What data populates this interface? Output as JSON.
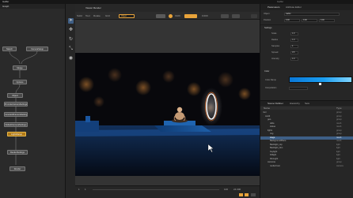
{
  "colors": {
    "accent_orange": "#e8a33a",
    "selection_blue": "#3e5f86",
    "gradient_start": "#0a78d8",
    "gradient_end": "#7fd4ff",
    "stage_blue": "#1e5fa8"
  },
  "app": {
    "title": "Gaffer",
    "top_left_menu": "Gaffer"
  },
  "nodegraph": {
    "tab": "Graph",
    "nodes": [
      "Sketch",
      "CameraSetup",
      "Merge",
      "Options",
      "Object",
      "PromoteCameraSettings",
      "PromoteAllCameraSettings",
      "DefaultCameraSettings",
      "LightsSetup",
      "RenderSettings",
      "Render"
    ]
  },
  "tools": [
    "select-icon",
    "translate-icon",
    "rotate-icon",
    "scale-icon",
    "camera-icon"
  ],
  "viewer": {
    "tab": "Viewer Render",
    "toolbar": {
      "item1": "Solid",
      "item2": "Tool",
      "item3": "Rotate",
      "item4": "Grid",
      "camera": "Object",
      "resolution": "1920",
      "expose": "0.000"
    },
    "bottom": {
      "frame_start": "1",
      "frame_current": "1",
      "frame_end": "100",
      "fps": "24.000"
    }
  },
  "parameters": {
    "tab": "Parameters",
    "tab2": "Attribute Editor",
    "node_name": "Object",
    "node_type": "Gaffer",
    "header_fields": [
      "Position",
      "0.00",
      "0.00",
      "0.00"
    ],
    "section": "Settings",
    "rows": [
      {
        "label": "Scale",
        "value": "1.0"
      },
      {
        "label": "Radius",
        "value": "1.0"
      },
      {
        "label": "Samples",
        "value": "4"
      },
      {
        "label": "Spread",
        "value": "0.5"
      },
      {
        "label": "Intensity",
        "value": "1.0"
      }
    ],
    "section2": "Color",
    "gradient_label": "Color Ramp",
    "gradient_sub": "Interpolation"
  },
  "outliner": {
    "tab": "Scene Outliner",
    "tab2": "Hierarchy",
    "tab3": "Sets",
    "col_name": "Name",
    "col_type": "Type",
    "rows": [
      {
        "indent": 0,
        "name": "root",
        "type": "group",
        "sel": false
      },
      {
        "indent": 1,
        "name": "world",
        "type": "group",
        "sel": false
      },
      {
        "indent": 2,
        "name": "geo",
        "type": "group",
        "sel": false
      },
      {
        "indent": 3,
        "name": "table",
        "type": "mesh",
        "sel": false
      },
      {
        "indent": 3,
        "name": "statue",
        "type": "mesh",
        "sel": false
      },
      {
        "indent": 2,
        "name": "lights",
        "type": "group",
        "sel": false
      },
      {
        "indent": 3,
        "name": "ring",
        "type": "group",
        "sel": false
      },
      {
        "indent": 3,
        "name": "stage",
        "type": "mesh",
        "sel": true
      },
      {
        "indent": 3,
        "name": "BackgroundPlane",
        "type": "mesh",
        "sel": false
      },
      {
        "indent": 3,
        "name": "Backlight_top",
        "type": "light",
        "sel": false
      },
      {
        "indent": 3,
        "name": "Backlight_btm",
        "type": "light",
        "sel": false
      },
      {
        "indent": 3,
        "name": "Keylight",
        "type": "light",
        "sel": false
      },
      {
        "indent": 3,
        "name": "Filllight",
        "type": "light",
        "sel": false
      },
      {
        "indent": 3,
        "name": "RimLight",
        "type": "light",
        "sel": false
      },
      {
        "indent": 2,
        "name": "cameras",
        "type": "group",
        "sel": false
      },
      {
        "indent": 3,
        "name": "renderCam",
        "type": "camera",
        "sel": false
      }
    ]
  }
}
